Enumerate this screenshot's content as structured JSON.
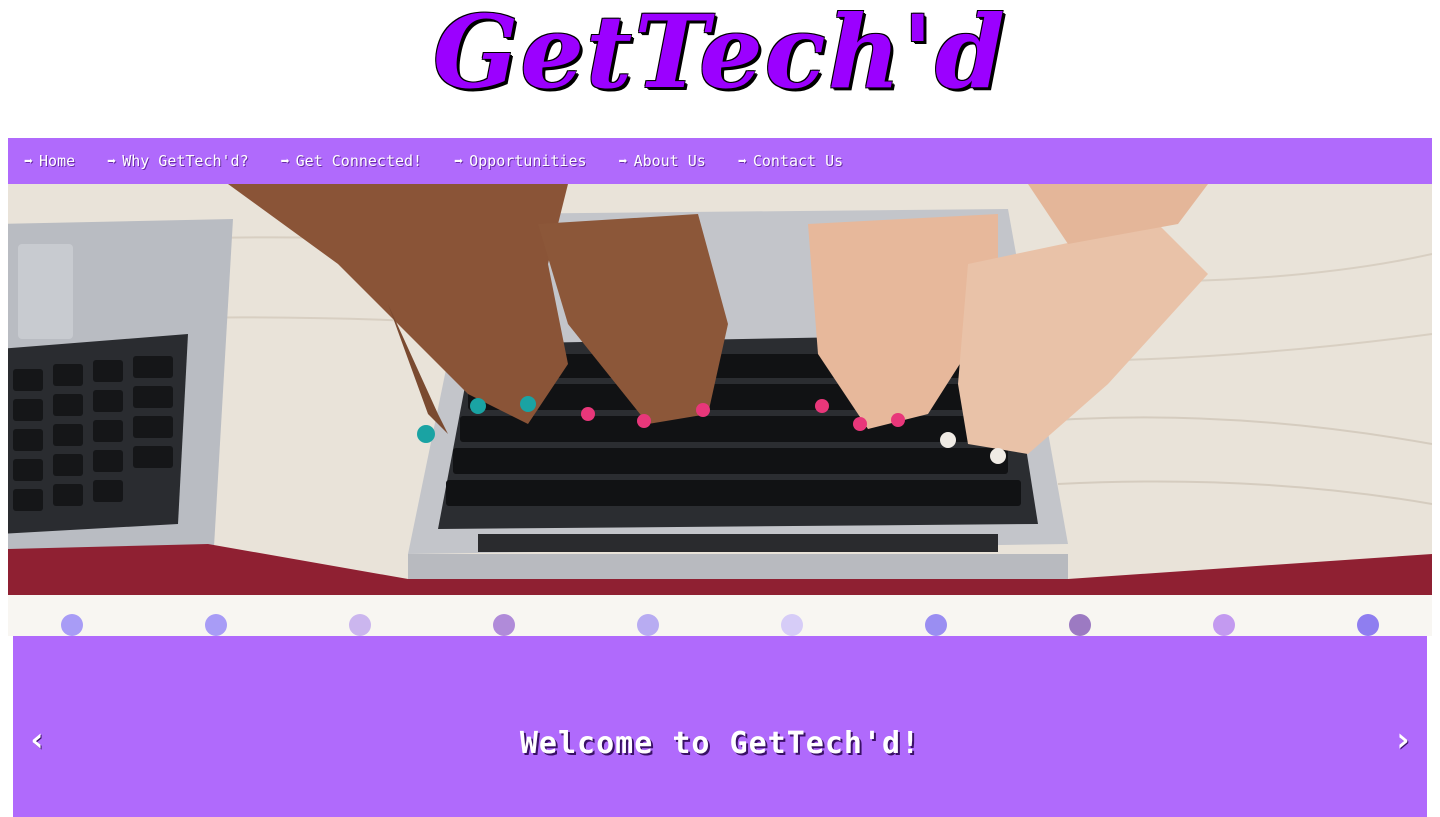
{
  "site": {
    "logo_text": "GetTech'd"
  },
  "nav": {
    "arrow": "➡",
    "items": [
      {
        "label": "Home"
      },
      {
        "label": "Why GetTech'd?"
      },
      {
        "label": "Get Connected!"
      },
      {
        "label": "Opportunities"
      },
      {
        "label": "About Us"
      },
      {
        "label": "Contact Us"
      }
    ]
  },
  "hero": {
    "image": "hands-typing-on-laptops-photo"
  },
  "carousel": {
    "indicator_colors": [
      "#a89cf6",
      "#a89cf6",
      "#cbb6ee",
      "#b08bd9",
      "#b8acf2",
      "#d6ccf7",
      "#9a8ef2",
      "#9c7ac2",
      "#c39af0",
      "#8f7ef0"
    ],
    "slide_text": "Welcome to GetTech'd!",
    "prev_icon": "‹",
    "next_icon": "›"
  },
  "colors": {
    "brand_purple": "#9b00ff",
    "nav_background": "#b06afc"
  }
}
